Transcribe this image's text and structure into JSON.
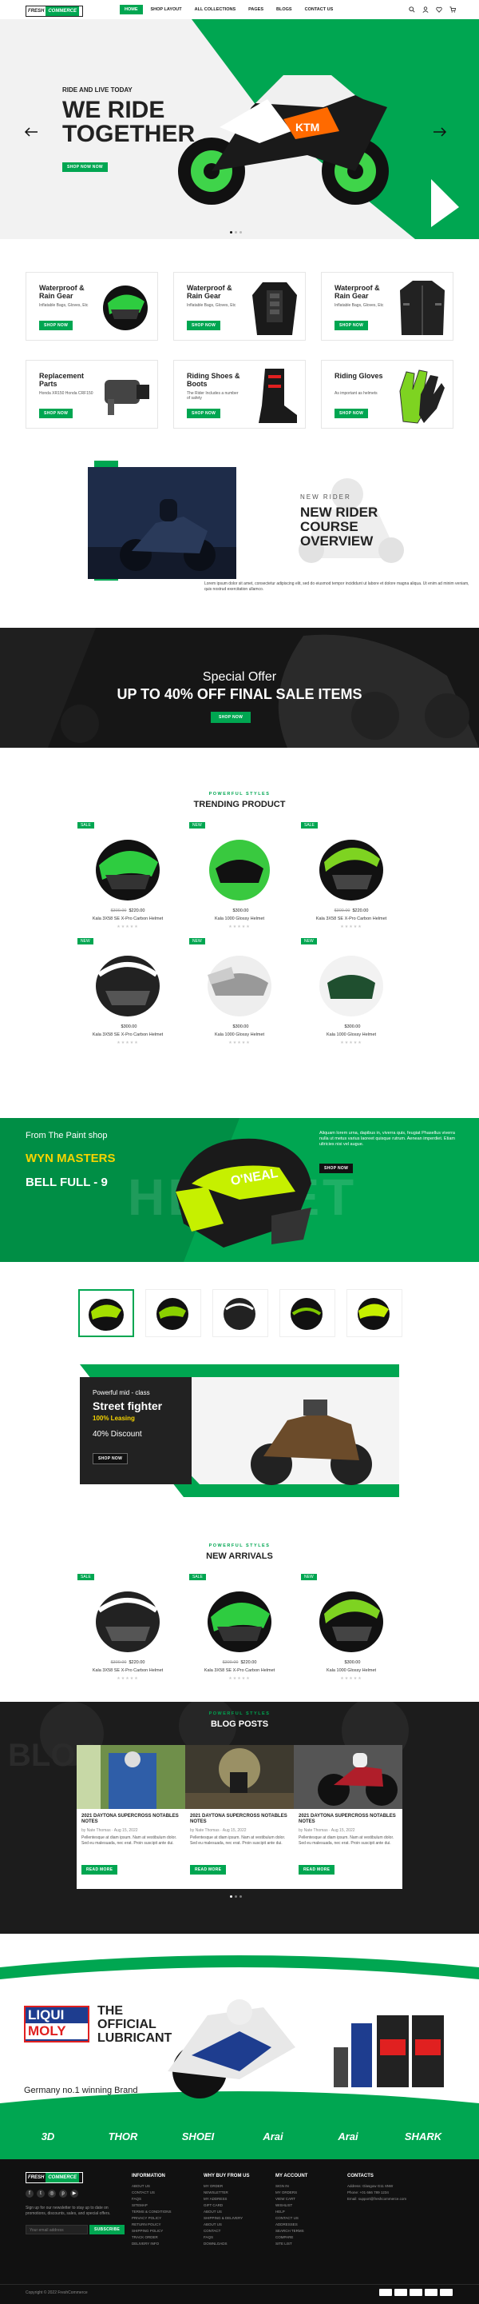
{
  "header": {
    "logo_a": "FRESH",
    "logo_b": "COMMERCE",
    "nav": [
      "HOME",
      "SHOP LAYOUT",
      "ALL COLLECTIONS",
      "PAGES",
      "BLOGS",
      "CONTACT US"
    ]
  },
  "hero": {
    "sub": "RIDE AND LIVE TODAY",
    "title": "WE RIDE TOGETHER",
    "button": "SHOP NOW NOW",
    "prev_icon": "arrow-left-icon",
    "next_icon": "arrow-right-icon"
  },
  "categories": [
    {
      "title": "Waterproof & Rain Gear",
      "desc": "Inflatable Bags, Gloves, Etc",
      "btn": "SHOP NOW"
    },
    {
      "title": "Waterproof & Rain Gear",
      "desc": "Inflatable Bags, Gloves, Etc",
      "btn": "SHOP NOW"
    },
    {
      "title": "Waterproof & Rain Gear",
      "desc": "Inflatable Bags, Gloves, Etc",
      "btn": "SHOP NOW"
    },
    {
      "title": "Replacement Parts",
      "desc": "Honda XR150 Honda CRF150",
      "btn": "SHOP NOW"
    },
    {
      "title": "Riding Shoes & Boots",
      "desc": "The Rider Includes a number of safety",
      "btn": "SHOP NOW"
    },
    {
      "title": "Riding Gloves",
      "desc": "As important as helmets",
      "btn": "SHOP NOW"
    }
  ],
  "rider": {
    "tag": "NEW RIDER",
    "title": "NEW RIDER COURSE OVERVIEW",
    "text": "Lorem ipsum dolor sit amet, consectetur adipiscing elit, sed do eiusmod tempor incididunt ut labore et dolore magna aliqua. Ut enim ad minim veniam, quis nostrud exercitation ullamco."
  },
  "offer": {
    "sub": "Special Offer",
    "title": "UP TO 40% OFF FINAL SALE ITEMS",
    "button": "SHOP NOW"
  },
  "trending": {
    "sub": "POWERFUL STYLES",
    "title": "TRENDING PRODUCT",
    "products": [
      {
        "badge": "SALE",
        "old": "$300.00",
        "price": "$220.00",
        "name": "Kala 3X58 SE X-Pro Carbon Helmet"
      },
      {
        "badge": "NEW",
        "old": "",
        "price": "$300.00",
        "name": "Kala 1000 Glossy Helmet"
      },
      {
        "badge": "SALE",
        "old": "$300.00",
        "price": "$220.00",
        "name": "Kala 3X58 SE X-Pro Carbon Helmet"
      },
      {
        "badge": "NEW",
        "old": "",
        "price": "$300.00",
        "name": "Kala 3X58 SE X-Pro Carbon Helmet"
      },
      {
        "badge": "NEW",
        "old": "",
        "price": "$300.00",
        "name": "Kala 1000 Glossy Helmet"
      },
      {
        "badge": "NEW",
        "old": "",
        "price": "$300.00",
        "name": "Kala 1000 Glossy Helmet"
      }
    ],
    "stars": "★★★★★"
  },
  "wyn": {
    "from": "From The Paint shop",
    "name": "WYN MASTERS",
    "model": "BELL FULL - 9",
    "bg": "HELMET",
    "text": "Aliquam lorem urna, dapibus in, viverra quis, feugiat Phasellus viverra nulla ut metus varius laoreet quisque rutrum. Aenean imperdiet. Etiam ultricies nisi vel augue.",
    "button": "SHOP NOW"
  },
  "street": {
    "sub": "Powerful mid - class",
    "title": "Street fighter",
    "leasing": "100% Leasing",
    "discount": "40% Discount",
    "button": "SHOP NOW"
  },
  "arrivals": {
    "sub": "POWERFUL STYLES",
    "title": "NEW ARRIVALS",
    "products": [
      {
        "badge": "SALE",
        "old": "$300.00",
        "price": "$220.00",
        "name": "Kala 3X58 SE X-Pro Carbon Helmet"
      },
      {
        "badge": "SALE",
        "old": "$300.00",
        "price": "$220.00",
        "name": "Kala 3X58 SE X-Pro Carbon Helmet"
      },
      {
        "badge": "NEW",
        "old": "",
        "price": "$300.00",
        "name": "Kala 1000 Glossy Helmet"
      }
    ]
  },
  "blog": {
    "sub": "POWERFUL STYLES",
    "title": "BLOG POSTS",
    "posts": [
      {
        "title": "2021 DAYTONA SUPERCROSS NOTABLES NOTES",
        "meta": "by Nate Thomas · Aug 15, 2022",
        "text": "Pellentesque at diam ipsum. Nam at vestibulum dolor. Sed eu malesuada, nec erat. Proin suscipit ante dui.",
        "btn": "Read more"
      },
      {
        "title": "2021 DAYTONA SUPERCROSS NOTABLES NOTES",
        "meta": "by Nate Thomas · Aug 15, 2022",
        "text": "Pellentesque at diam ipsum. Nam at vestibulum dolor. Sed eu malesuada, nec erat. Proin suscipit ante dui.",
        "btn": "Read more"
      },
      {
        "title": "2021 DAYTONA SUPERCROSS NOTABLES NOTES",
        "meta": "by Nate Thomas · Aug 15, 2022",
        "text": "Pellentesque at diam ipsum. Nam at vestibulum dolor. Sed eu malesuada, nec erat. Proin suscipit ante dui.",
        "btn": "Read more"
      }
    ]
  },
  "liqui": {
    "logo_a": "LIQUI",
    "logo_b": "MOLY",
    "title_a": "THE",
    "title_b": "OFFICIAL",
    "title_c": "LUBRICANT",
    "tagline": "Germany no.1 winning Brand"
  },
  "brands": [
    "3D",
    "THOR",
    "SHOEI",
    "Arai",
    "Arai",
    "SHARK"
  ],
  "footer": {
    "logo_a": "FRESH",
    "logo_b": "COMMERCE",
    "signup": "Sign up for our newsletter to stay up to date on promotions, discounts, sales, and special offers.",
    "email_placeholder": "Your email address",
    "subscribe": "SUBSCRIBE",
    "info": {
      "title": "INFORMATION",
      "links": [
        "ABOUT US",
        "CONTACT US",
        "FAQS",
        "SITEMAP",
        "TERMS & CONDITIONS",
        "PRIVACY POLICY",
        "RETURN POLICY",
        "SHIPPING POLICY",
        "TRACK ORDER",
        "DELIVERY INFO"
      ]
    },
    "why": {
      "title": "WHY BUY FROM US",
      "links": [
        "MY ORDER",
        "NEWSLETTER",
        "MY ADDRESS",
        "GIFT CARD",
        "ABOUT US",
        "SHIPPING & DELIVERY",
        "ABOUT US",
        "CONTACT",
        "FAQS",
        "DOWNLOADS"
      ]
    },
    "account": {
      "title": "MY ACCOUNT",
      "links": [
        "SIGN IN",
        "MY ORDERS",
        "VIEW CART",
        "WISHLIST",
        "HELP",
        "CONTACT US",
        "ADDRESSES",
        "SEARCH TERMS",
        "COMPARE",
        "SITE LIST"
      ]
    },
    "contact": {
      "title": "CONTACTS",
      "address": "Address: Glasgow G11 6NW",
      "phone": "Phone: +01 666 789 1234",
      "email": "Email: support@freshcommerce.com"
    },
    "copyright": "Copyright © 2022 FreshCommerce"
  },
  "colors": {
    "accent": "#00a651",
    "dark": "#151515",
    "yellow": "#f6d400"
  }
}
